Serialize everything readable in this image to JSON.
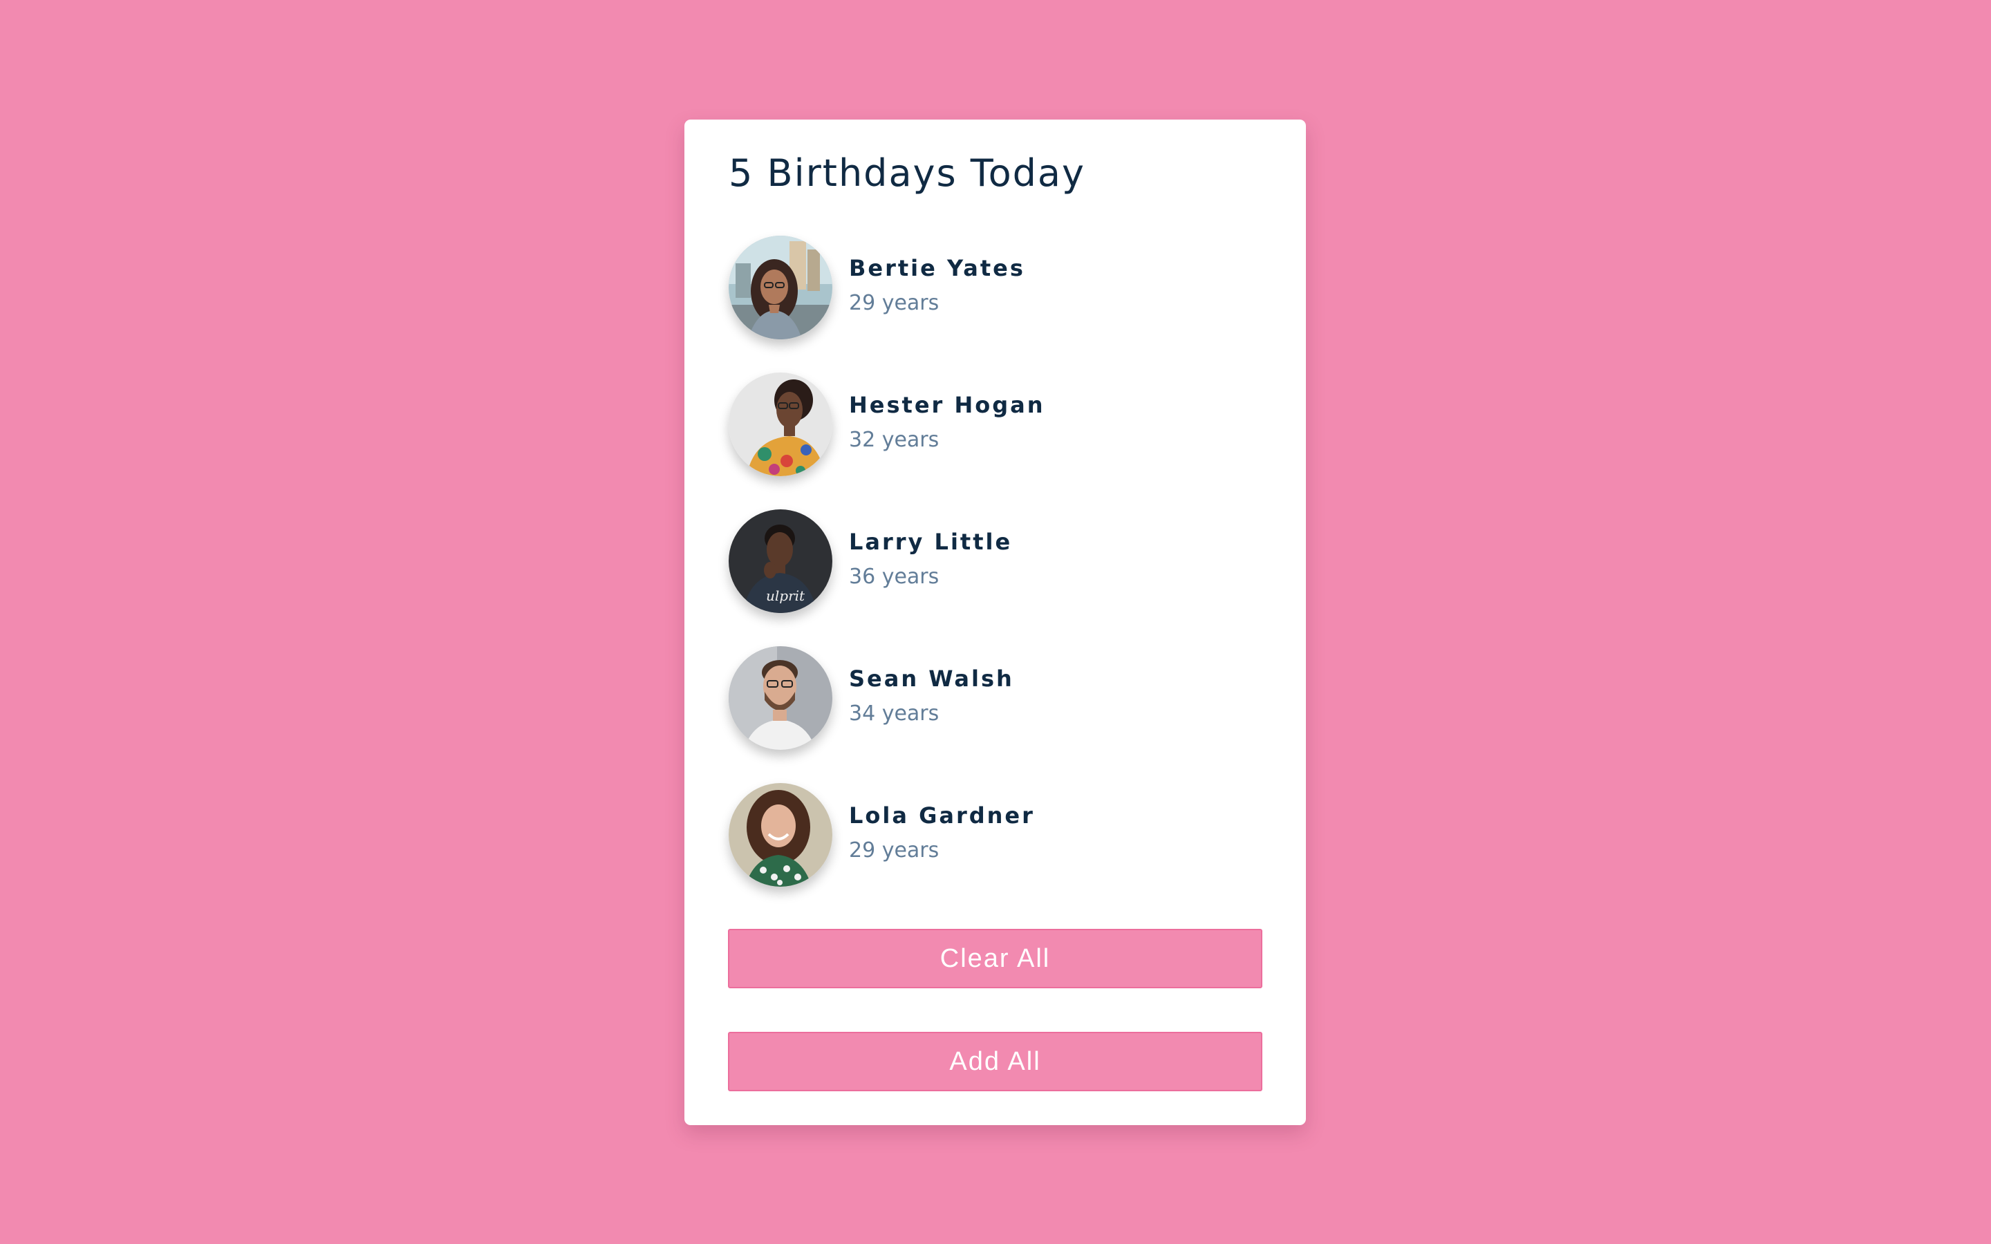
{
  "title": "5 Birthdays Today",
  "people": [
    {
      "name": "Bertie Yates",
      "age": "29 years",
      "avatar": "woman-with-glasses-city-street-photo"
    },
    {
      "name": "Hester Hogan",
      "age": "32 years",
      "avatar": "woman-with-glasses-floral-shirt-photo"
    },
    {
      "name": "Larry Little",
      "age": "36 years",
      "avatar": "man-thinking-dark-background-photo"
    },
    {
      "name": "Sean Walsh",
      "age": "34 years",
      "avatar": "man-with-glasses-beard-photo"
    },
    {
      "name": "Lola Gardner",
      "age": "29 years",
      "avatar": "woman-curly-hair-smiling-photo"
    }
  ],
  "buttons": {
    "clear": "Clear All",
    "add": "Add All"
  },
  "colors": {
    "background": "#f28ab0",
    "button": "#f28ab0",
    "heading": "#102a43",
    "subtext": "#627d98"
  }
}
